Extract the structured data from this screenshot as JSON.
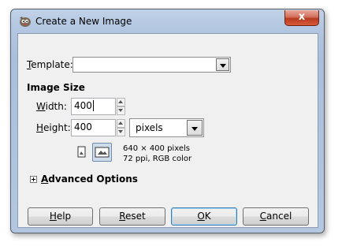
{
  "window": {
    "title": "Create a New Image",
    "close_label": "x"
  },
  "template": {
    "label_mnemonic": "T",
    "label_rest": "emplate:",
    "value": ""
  },
  "image_size": {
    "heading": "Image Size",
    "width_label_mnemonic": "W",
    "width_label_rest": "idth:",
    "width_value": "400",
    "height_label_mnemonic": "H",
    "height_label_rest": "eight:",
    "height_value": "400",
    "unit": "pixels",
    "info_line1": "640 × 400 pixels",
    "info_line2": "72 ppi, RGB color"
  },
  "advanced": {
    "label_mnemonic": "A",
    "label_rest": "dvanced Options"
  },
  "buttons": {
    "help_mnemonic": "H",
    "help_rest": "elp",
    "reset_mnemonic": "R",
    "reset_rest": "eset",
    "ok_mnemonic": "O",
    "ok_rest": "K",
    "cancel_mnemonic": "C",
    "cancel_rest": "ancel"
  },
  "colors": {
    "titlebar": "#b5c8e2",
    "client_bg": "#f0f0f0",
    "close_red": "#c8452a",
    "default_button_border": "#3c7fb1"
  },
  "icons": {
    "app": "gimp-icon",
    "close": "close-icon",
    "chain": "chain-link-icon",
    "portrait": "portrait-orientation-icon",
    "landscape": "landscape-orientation-icon",
    "expander": "expand-plus-icon"
  }
}
